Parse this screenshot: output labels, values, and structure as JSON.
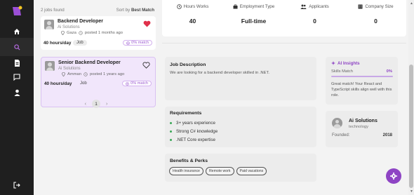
{
  "sidebar": {
    "items": [
      {
        "name": "home",
        "icon": "home-icon"
      },
      {
        "name": "search",
        "icon": "search-icon"
      },
      {
        "name": "documents",
        "icon": "document-icon"
      },
      {
        "name": "messages",
        "icon": "chat-icon"
      },
      {
        "name": "profile",
        "icon": "user-icon"
      },
      {
        "name": "logout",
        "icon": "logout-icon"
      }
    ],
    "active": "search"
  },
  "job_list": {
    "count_text": "2 jobs found",
    "sort_label": "Sort by",
    "sort_value": "Best Match",
    "jobs": [
      {
        "title": "Backend Developer",
        "company": "Ai Solutions",
        "location": "Gaza",
        "posted": "posted 1 months ago",
        "hours": "40 hours/day",
        "type": "Job",
        "match": "0% match",
        "favorited": true
      },
      {
        "title": "Senior Backend Developer",
        "company": "Ai Solutions",
        "location": "Amman",
        "posted": "posted 1 years ago",
        "hours": "40 hours/day",
        "type": "Job",
        "match": "0% match",
        "favorited": false
      }
    ],
    "pagination": {
      "current": "1",
      "prev": "‹",
      "next": "›"
    }
  },
  "stats": [
    {
      "label": "Hours Works",
      "value": "40",
      "icon": "clock-icon"
    },
    {
      "label": "Employment Type",
      "value": "Full-time",
      "icon": "briefcase-icon"
    },
    {
      "label": "Applicants",
      "value": "0",
      "icon": "users-icon"
    },
    {
      "label": "Company Size",
      "value": "0",
      "icon": "building-icon"
    }
  ],
  "description": {
    "title": "Job Description",
    "text": "We are looking for a backend developer skilled in .NET."
  },
  "requirements": {
    "title": "Requirements",
    "items": [
      "3+ years experience",
      "Strong C# knowledge",
      ".NET Core expertise"
    ]
  },
  "benefits": {
    "title": "Benefits & Perks",
    "items": [
      "Health insurance",
      "Remote work",
      "Paid vacations"
    ]
  },
  "ai_insights": {
    "title": "AI Insights",
    "skills_match_label": "Skills Match",
    "skills_match_value": "0%",
    "skills_match_fraction": 0,
    "text": "Great match! Your React and TypeScript skills align well with this role."
  },
  "company": {
    "name": "Ai Solutions",
    "industry": "technology",
    "founded_label": "Founded:",
    "founded_value": "2018"
  },
  "colors": {
    "accent": "#8e44c4",
    "favorite": "#e0314b",
    "bullet": "#3aa857",
    "sidebar_bg": "#1f1f1f"
  }
}
